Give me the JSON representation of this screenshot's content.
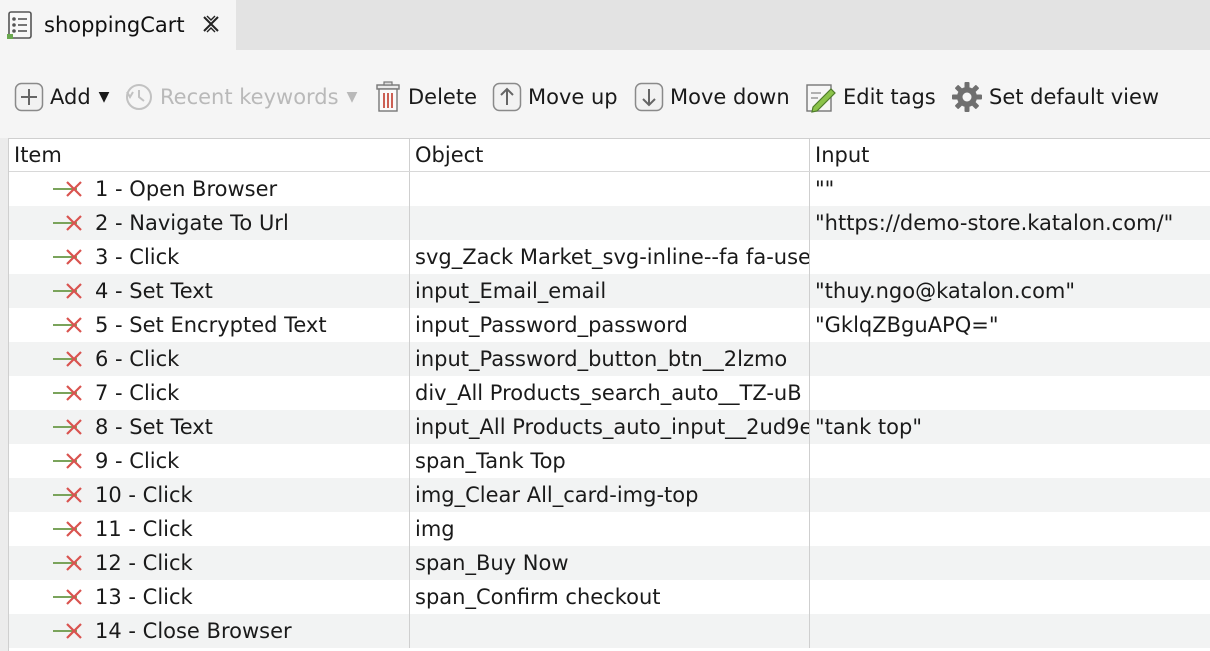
{
  "tab": {
    "title": "shoppingCart",
    "icon": "test-case-icon",
    "close_icon": "close-icon"
  },
  "toolbar": {
    "add_label": "Add",
    "recent_label": "Recent keywords",
    "delete_label": "Delete",
    "move_up_label": "Move up",
    "move_down_label": "Move down",
    "edit_tags_label": "Edit tags",
    "set_default_view_label": "Set default view"
  },
  "table": {
    "columns": [
      "Item",
      "Object",
      "Input"
    ],
    "rows": [
      {
        "item": "1 - Open Browser",
        "object": "",
        "input": "\"\""
      },
      {
        "item": "2 - Navigate To Url",
        "object": "",
        "input": "\"https://demo-store.katalon.com/\""
      },
      {
        "item": "3 - Click",
        "object": "svg_Zack Market_svg-inline--fa fa-user",
        "input": ""
      },
      {
        "item": "4 - Set Text",
        "object": "input_Email_email",
        "input": "\"thuy.ngo@katalon.com\""
      },
      {
        "item": "5 - Set Encrypted Text",
        "object": "input_Password_password",
        "input": "\"GklqZBguAPQ=\""
      },
      {
        "item": "6 - Click",
        "object": "input_Password_button_btn__2lzmo",
        "input": ""
      },
      {
        "item": "7 - Click",
        "object": "div_All Products_search_auto__TZ-uB",
        "input": ""
      },
      {
        "item": "8 - Set Text",
        "object": "input_All Products_auto_input__2ud9e",
        "input": "\"tank top\""
      },
      {
        "item": "9 - Click",
        "object": "span_Tank Top",
        "input": ""
      },
      {
        "item": "10 - Click",
        "object": "img_Clear All_card-img-top",
        "input": ""
      },
      {
        "item": "11 - Click",
        "object": "img",
        "input": ""
      },
      {
        "item": "12 - Click",
        "object": "span_Buy Now",
        "input": ""
      },
      {
        "item": "13 - Click",
        "object": "span_Confirm checkout",
        "input": ""
      },
      {
        "item": "14 - Close Browser",
        "object": "",
        "input": ""
      }
    ]
  },
  "colors": {
    "step_arrow": "#7aa35b",
    "step_x": "#d9534f",
    "row_alt": "#f2f3f3"
  }
}
